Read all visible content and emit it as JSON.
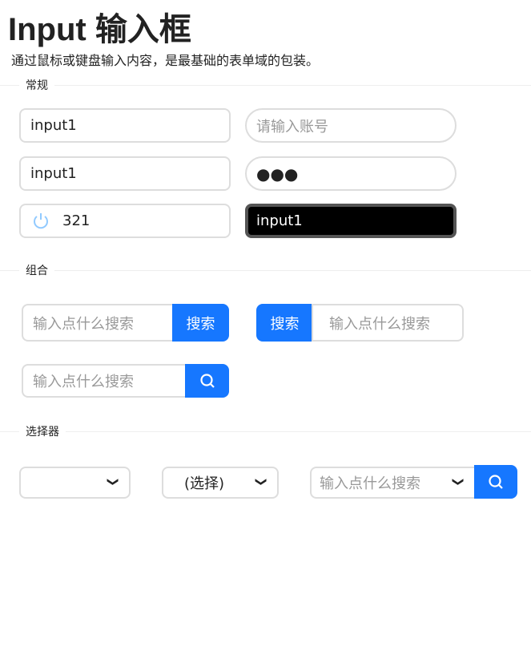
{
  "title": "Input 输入框",
  "subtitle": "通过鼠标或键盘输入内容，是最基础的表单域的包装。",
  "sections": {
    "basic": "常规",
    "group": "组合",
    "select": "选择器"
  },
  "basic": {
    "input1": "input1",
    "account_placeholder": "请输入账号",
    "input2": "input1",
    "password": "●●●",
    "number": "321",
    "dark": "input1"
  },
  "group": {
    "placeholder": "输入点什么搜索",
    "search_label": "搜索"
  },
  "selects": {
    "select2_value": "(选择)",
    "search_placeholder": "输入点什么搜索"
  },
  "colors": {
    "primary": "#1677ff"
  }
}
